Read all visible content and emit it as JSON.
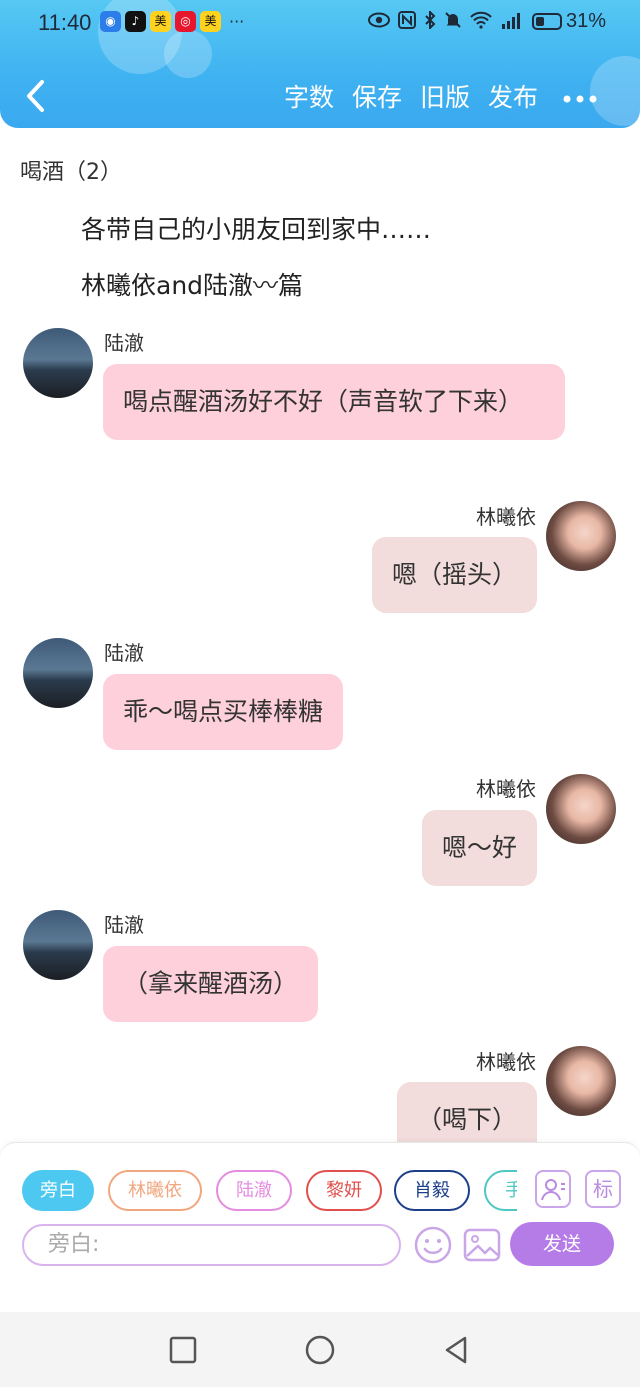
{
  "status_bar": {
    "time": "11:40",
    "app_icons": [
      {
        "name": "shield-app-icon",
        "glyph": "◉",
        "color": "#2b7de9"
      },
      {
        "name": "tiktok-icon",
        "glyph": "♪",
        "color": "#111111"
      },
      {
        "name": "meituan-icon",
        "glyph": "美",
        "color": "#ffd21f"
      },
      {
        "name": "weibo-icon",
        "glyph": "◎",
        "color": "#e6162d"
      },
      {
        "name": "meituan-icon-2",
        "glyph": "美",
        "color": "#ffd21f"
      }
    ],
    "more_apps": "···",
    "battery_percent": "31%",
    "battery_level": 0.31
  },
  "toolbar": {
    "word_count": "字数",
    "save": "保存",
    "old_version": "旧版",
    "publish": "发布"
  },
  "chapter": {
    "title": "喝酒（2）",
    "intro": [
      "各带自己的小朋友回到家中……",
      "林曦依and陆澈〰篇"
    ]
  },
  "messages": [
    {
      "speaker": "陆澈",
      "side": "left",
      "text": "喝点醒酒汤好不好（声音软了下来）"
    },
    {
      "speaker": "林曦依",
      "side": "right",
      "text": "嗯（摇头）"
    },
    {
      "speaker": "陆澈",
      "side": "left",
      "text": "乖～喝点买棒棒糖"
    },
    {
      "speaker": "林曦依",
      "side": "right",
      "text": "嗯～好"
    },
    {
      "speaker": "陆澈",
      "side": "left",
      "text": "（拿来醒酒汤）"
    },
    {
      "speaker": "林曦依",
      "side": "right",
      "text": "（喝下）"
    }
  ],
  "composer": {
    "roles": [
      {
        "label": "旁白",
        "color": "#4cc8f1",
        "active": true
      },
      {
        "label": "林曦依",
        "color": "#f0a77f",
        "active": false
      },
      {
        "label": "陆澈",
        "color": "#e48ce0",
        "active": false
      },
      {
        "label": "黎妍",
        "color": "#e0514e",
        "active": false
      },
      {
        "label": "肖毅",
        "color": "#1c3f8a",
        "active": false
      },
      {
        "label": "手",
        "color": "#4ec7c3",
        "active": false
      }
    ],
    "tag_button": "标",
    "input_placeholder": "旁白:",
    "send_label": "发送"
  }
}
